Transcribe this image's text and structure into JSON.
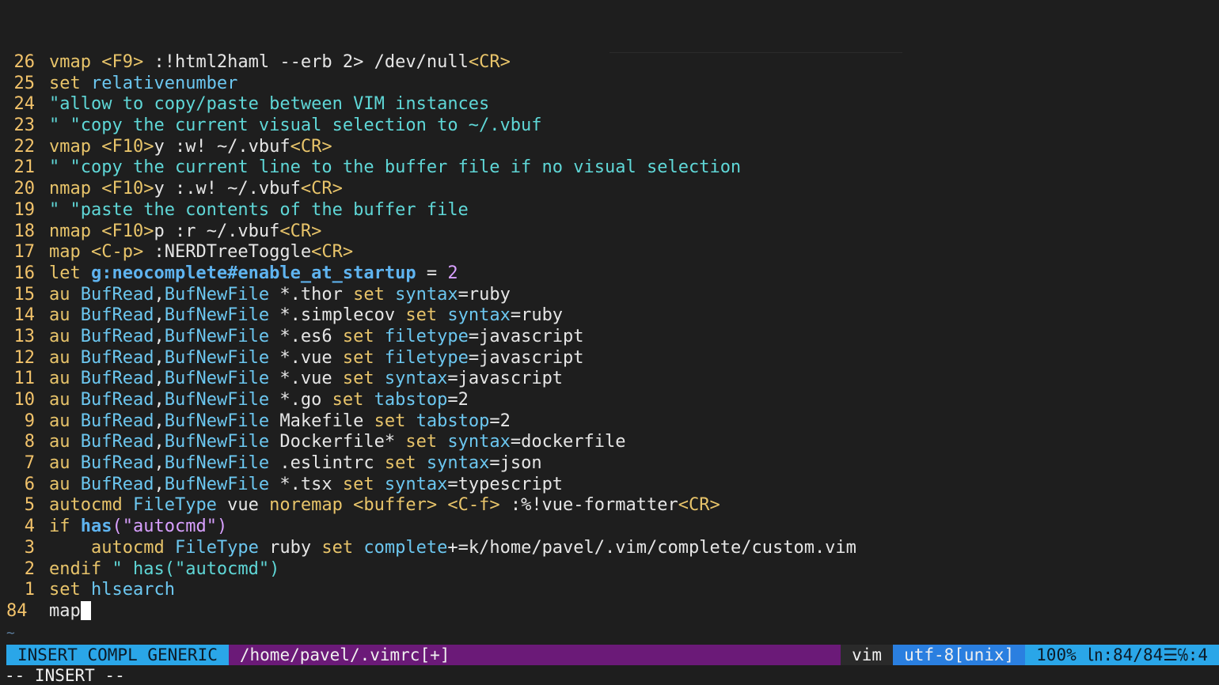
{
  "lines": [
    {
      "num": "26",
      "segs": [
        [
          "k",
          "vmap "
        ],
        [
          "t",
          "<F9>"
        ],
        [
          "w",
          " :!html2haml --erb 2> /dev/null"
        ],
        [
          "t",
          "<CR>"
        ]
      ]
    },
    {
      "num": "25",
      "segs": [
        [
          "k",
          "set "
        ],
        [
          "o",
          "relativenumber"
        ]
      ]
    },
    {
      "num": "24",
      "segs": [
        [
          "c",
          "\"allow to copy/paste between VIM instances"
        ]
      ]
    },
    {
      "num": "23",
      "segs": [
        [
          "c",
          "\" \"copy the current visual selection to ~/.vbuf"
        ]
      ]
    },
    {
      "num": "22",
      "segs": [
        [
          "k",
          "vmap "
        ],
        [
          "t",
          "<F10>"
        ],
        [
          "w",
          "y :w! ~/.vbuf"
        ],
        [
          "t",
          "<CR>"
        ]
      ]
    },
    {
      "num": "21",
      "segs": [
        [
          "c",
          "\" \"copy the current line to the buffer file if no visual selection"
        ]
      ]
    },
    {
      "num": "20",
      "segs": [
        [
          "k",
          "nmap "
        ],
        [
          "t",
          "<F10>"
        ],
        [
          "w",
          "y :.w! ~/.vbuf"
        ],
        [
          "t",
          "<CR>"
        ]
      ]
    },
    {
      "num": "19",
      "segs": [
        [
          "c",
          "\" \"paste the contents of the buffer file"
        ]
      ]
    },
    {
      "num": "18",
      "segs": [
        [
          "k",
          "nmap "
        ],
        [
          "t",
          "<F10>"
        ],
        [
          "w",
          "p :r ~/.vbuf"
        ],
        [
          "t",
          "<CR>"
        ]
      ]
    },
    {
      "num": "17",
      "segs": [
        [
          "k",
          "map "
        ],
        [
          "t",
          "<C-p>"
        ],
        [
          "w",
          " :NERDTreeToggle"
        ],
        [
          "t",
          "<CR>"
        ]
      ]
    },
    {
      "num": "16",
      "segs": [
        [
          "k",
          "let "
        ],
        [
          "b",
          "g:neocomplete#enable_at_startup"
        ],
        [
          "w",
          " = "
        ],
        [
          "s",
          "2"
        ]
      ]
    },
    {
      "num": "15",
      "segs": [
        [
          "k",
          "au "
        ],
        [
          "o",
          "BufRead"
        ],
        [
          "w",
          ","
        ],
        [
          "o",
          "BufNewFile"
        ],
        [
          "w",
          " *.thor "
        ],
        [
          "k",
          "set "
        ],
        [
          "o",
          "syntax"
        ],
        [
          "w",
          "=ruby"
        ]
      ]
    },
    {
      "num": "14",
      "segs": [
        [
          "k",
          "au "
        ],
        [
          "o",
          "BufRead"
        ],
        [
          "w",
          ","
        ],
        [
          "o",
          "BufNewFile"
        ],
        [
          "w",
          " *.simplecov "
        ],
        [
          "k",
          "set "
        ],
        [
          "o",
          "syntax"
        ],
        [
          "w",
          "=ruby"
        ]
      ]
    },
    {
      "num": "13",
      "segs": [
        [
          "k",
          "au "
        ],
        [
          "o",
          "BufRead"
        ],
        [
          "w",
          ","
        ],
        [
          "o",
          "BufNewFile"
        ],
        [
          "w",
          " *.es6 "
        ],
        [
          "k",
          "set "
        ],
        [
          "o",
          "filetype"
        ],
        [
          "w",
          "=javascript"
        ]
      ]
    },
    {
      "num": "12",
      "segs": [
        [
          "k",
          "au "
        ],
        [
          "o",
          "BufRead"
        ],
        [
          "w",
          ","
        ],
        [
          "o",
          "BufNewFile"
        ],
        [
          "w",
          " *.vue "
        ],
        [
          "k",
          "set "
        ],
        [
          "o",
          "filetype"
        ],
        [
          "w",
          "=javascript"
        ]
      ]
    },
    {
      "num": "11",
      "segs": [
        [
          "k",
          "au "
        ],
        [
          "o",
          "BufRead"
        ],
        [
          "w",
          ","
        ],
        [
          "o",
          "BufNewFile"
        ],
        [
          "w",
          " *.vue "
        ],
        [
          "k",
          "set "
        ],
        [
          "o",
          "syntax"
        ],
        [
          "w",
          "=javascript"
        ]
      ]
    },
    {
      "num": "10",
      "segs": [
        [
          "k",
          "au "
        ],
        [
          "o",
          "BufRead"
        ],
        [
          "w",
          ","
        ],
        [
          "o",
          "BufNewFile"
        ],
        [
          "w",
          " *.go "
        ],
        [
          "k",
          "set "
        ],
        [
          "o",
          "tabstop"
        ],
        [
          "w",
          "=2"
        ]
      ]
    },
    {
      "num": "9",
      "segs": [
        [
          "k",
          "au "
        ],
        [
          "o",
          "BufRead"
        ],
        [
          "w",
          ","
        ],
        [
          "o",
          "BufNewFile"
        ],
        [
          "w",
          " Makefile "
        ],
        [
          "k",
          "set "
        ],
        [
          "o",
          "tabstop"
        ],
        [
          "w",
          "=2"
        ]
      ]
    },
    {
      "num": "8",
      "segs": [
        [
          "k",
          "au "
        ],
        [
          "o",
          "BufRead"
        ],
        [
          "w",
          ","
        ],
        [
          "o",
          "BufNewFile"
        ],
        [
          "w",
          " Dockerfile* "
        ],
        [
          "k",
          "set "
        ],
        [
          "o",
          "syntax"
        ],
        [
          "w",
          "=dockerfile"
        ]
      ]
    },
    {
      "num": "7",
      "segs": [
        [
          "k",
          "au "
        ],
        [
          "o",
          "BufRead"
        ],
        [
          "w",
          ","
        ],
        [
          "o",
          "BufNewFile"
        ],
        [
          "w",
          " .eslintrc "
        ],
        [
          "k",
          "set "
        ],
        [
          "o",
          "syntax"
        ],
        [
          "w",
          "=json"
        ]
      ]
    },
    {
      "num": "6",
      "segs": [
        [
          "k",
          "au "
        ],
        [
          "o",
          "BufRead"
        ],
        [
          "w",
          ","
        ],
        [
          "o",
          "BufNewFile"
        ],
        [
          "w",
          " *.tsx "
        ],
        [
          "k",
          "set "
        ],
        [
          "o",
          "syntax"
        ],
        [
          "w",
          "=typescript"
        ]
      ]
    },
    {
      "num": "5",
      "segs": [
        [
          "k",
          "autocmd "
        ],
        [
          "o",
          "FileType"
        ],
        [
          "w",
          " vue "
        ],
        [
          "k",
          "noremap "
        ],
        [
          "t",
          "<buffer> <C-f>"
        ],
        [
          "w",
          " :%!vue-formatter"
        ],
        [
          "t",
          "<CR>"
        ]
      ]
    },
    {
      "num": "4",
      "segs": [
        [
          "k",
          "if "
        ],
        [
          "b",
          "has"
        ],
        [
          "s",
          "(\"autocmd\")"
        ]
      ]
    },
    {
      "num": "3",
      "segs": [
        [
          "w",
          "    "
        ],
        [
          "k",
          "autocmd "
        ],
        [
          "o",
          "FileType"
        ],
        [
          "w",
          " ruby "
        ],
        [
          "k",
          "set "
        ],
        [
          "o",
          "complete"
        ],
        [
          "w",
          "+=k/home/pavel/.vim/complete/custom.vim"
        ]
      ]
    },
    {
      "num": "2",
      "segs": [
        [
          "k",
          "endif "
        ],
        [
          "c",
          "\" has(\"autocmd\")"
        ]
      ]
    },
    {
      "num": "1",
      "segs": [
        [
          "k",
          "set "
        ],
        [
          "o",
          "hlsearch"
        ]
      ]
    }
  ],
  "current_line": {
    "num": "84",
    "text": "map"
  },
  "tilde": "~",
  "statusline": {
    "mode": "INSERT COMPL GENERIC",
    "file": "/home/pavel/.vimrc[+]",
    "filetype": "vim",
    "encoding": "utf-8[unix]",
    "position": "100% ㏑:84/84☰℅:4"
  },
  "cmdline": "-- INSERT --"
}
